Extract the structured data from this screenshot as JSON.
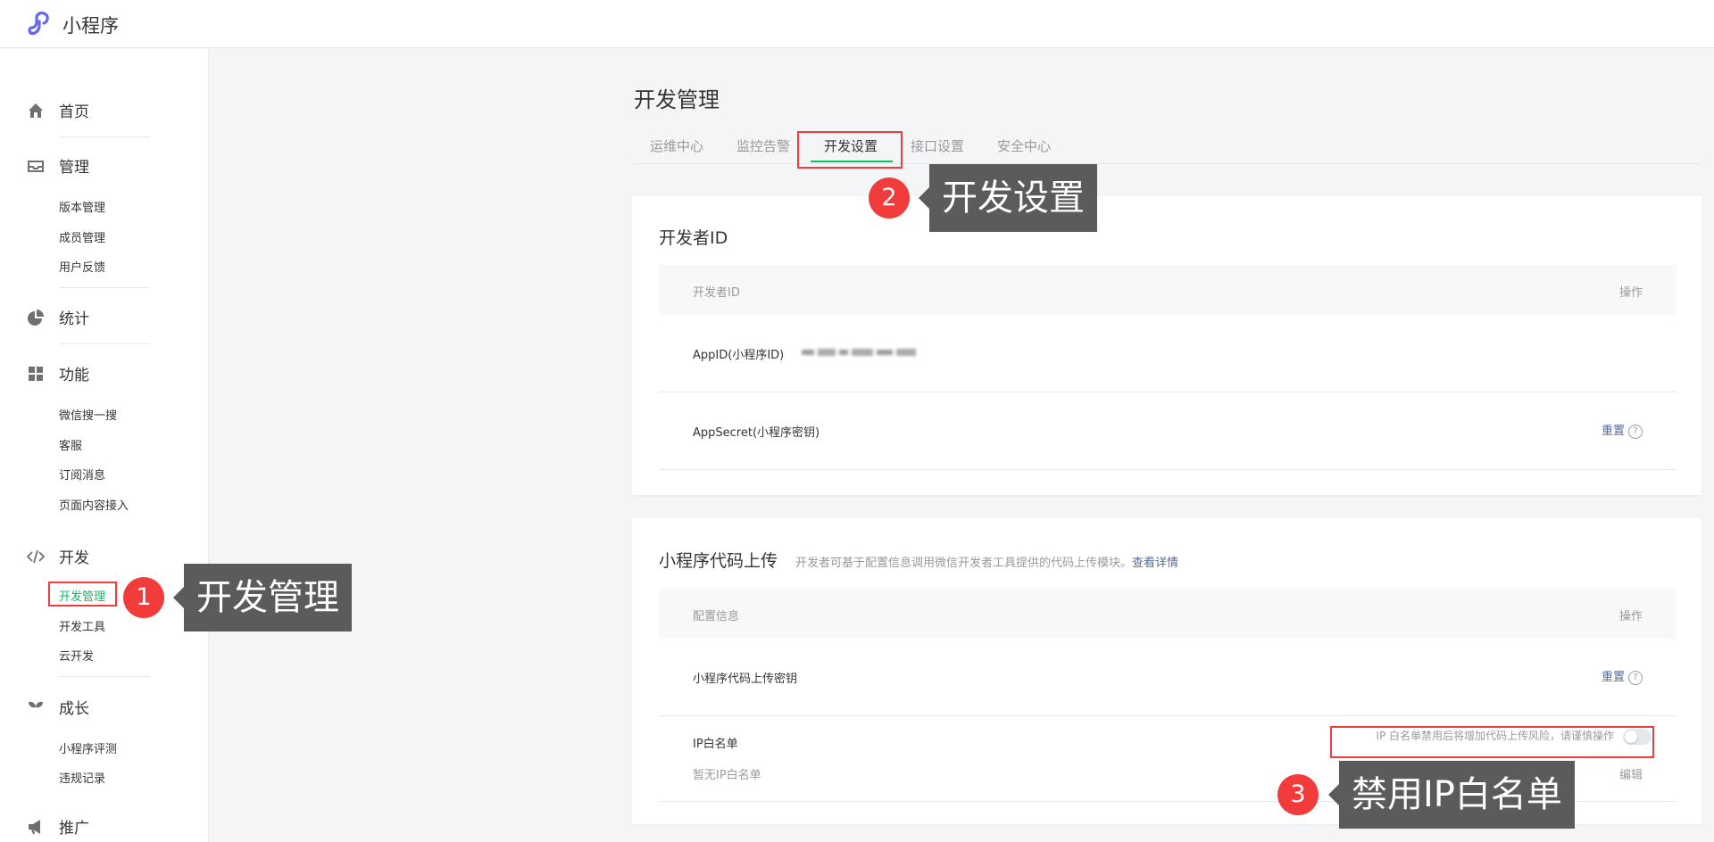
{
  "app": {
    "brand": "小程序"
  },
  "sidebar": {
    "sections": [
      {
        "title": "首页",
        "icon": "home-icon",
        "items": []
      },
      {
        "title": "管理",
        "icon": "inbox-icon",
        "items": [
          "版本管理",
          "成员管理",
          "用户反馈"
        ]
      },
      {
        "title": "统计",
        "icon": "pie-chart-icon",
        "items": []
      },
      {
        "title": "功能",
        "icon": "grid-icon",
        "items": [
          "微信搜一搜",
          "客服",
          "订阅消息",
          "页面内容接入"
        ]
      },
      {
        "title": "开发",
        "icon": "code-icon",
        "items": [
          "开发管理",
          "开发工具",
          "云开发"
        ]
      },
      {
        "title": "成长",
        "icon": "sprout-icon",
        "items": [
          "小程序评测",
          "违规记录"
        ]
      },
      {
        "title": "推广",
        "icon": "megaphone-icon",
        "items": []
      }
    ],
    "active_item": "开发管理"
  },
  "main": {
    "title": "开发管理",
    "tabs": [
      "运维中心",
      "监控告警",
      "开发设置",
      "接口设置",
      "安全中心"
    ],
    "active_tab": "开发设置",
    "developer_id": {
      "title": "开发者ID",
      "headers": [
        "开发者ID",
        "操作"
      ],
      "rows": [
        {
          "label": "AppID(小程序ID)",
          "value": "",
          "action": ""
        },
        {
          "label": "AppSecret(小程序密钥)",
          "value": "",
          "action": "重置"
        }
      ]
    },
    "code_upload": {
      "title": "小程序代码上传",
      "desc": "开发者可基于配置信息调用微信开发者工具提供的代码上传模块。",
      "desc_link": "查看详情",
      "headers": [
        "配置信息",
        "操作"
      ],
      "rows": [
        {
          "label": "小程序代码上传密钥",
          "action": "重置"
        },
        {
          "label": "IP白名单",
          "sub": "暂无IP白名单",
          "warning": "IP 白名单禁用后将增加代码上传风险，请谨慎操作",
          "action": "编辑",
          "toggle_on": false
        }
      ]
    }
  },
  "annotations": [
    {
      "number": "1",
      "text": "开发管理"
    },
    {
      "number": "2",
      "text": "开发设置"
    },
    {
      "number": "3",
      "text": "禁用IP白名单"
    }
  ],
  "colors": {
    "accent_green": "#07c160",
    "link_blue": "#576b95",
    "annotation_red": "#f23b3b",
    "callout_gray": "#5b5b5b"
  }
}
